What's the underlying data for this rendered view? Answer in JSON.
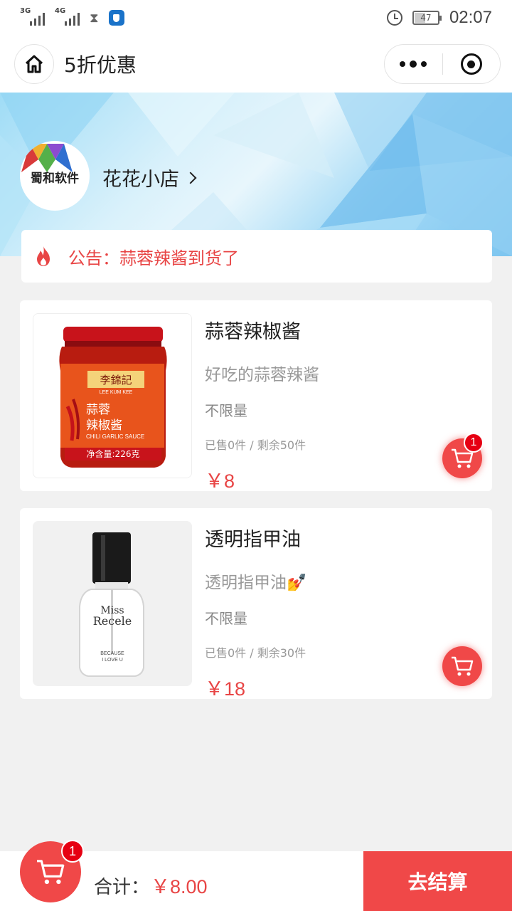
{
  "status_bar": {
    "network_1": "3G",
    "network_2": "4G",
    "battery": "47",
    "time": "02:07"
  },
  "nav": {
    "title": "5折优惠"
  },
  "shop": {
    "logo_text": "蜀和软件",
    "name": "花花小店"
  },
  "notice": {
    "text": "公告：蒜蓉辣酱到货了"
  },
  "products": [
    {
      "name": "蒜蓉辣椒酱",
      "desc": "好吃的蒜蓉辣酱",
      "limit": "不限量",
      "sold": "已售0件 / 剩余50件",
      "price": "￥8",
      "cart_count": "1",
      "image": {
        "brand": "李錦記",
        "brand_en": "LEE KUM KEE",
        "label": "蒜蓉辣椒酱",
        "label_en": "CHILI GARLIC SAUCE",
        "net": "净含量:226克"
      }
    },
    {
      "name": "透明指甲油",
      "desc": "透明指甲油💅",
      "limit": "不限量",
      "sold": "已售0件 / 剩余30件",
      "price": "￥18",
      "cart_count": "",
      "image": {
        "brand_1": "Miss",
        "brand_2": "Recele",
        "slogan_1": "BECAUSE",
        "slogan_2": "I LOVE U"
      }
    }
  ],
  "bottom": {
    "cart_count": "1",
    "total_label": "合计：",
    "total_amount": "￥8.00",
    "checkout": "去结算"
  },
  "colors": {
    "accent": "#f04848",
    "price": "#e84545"
  }
}
